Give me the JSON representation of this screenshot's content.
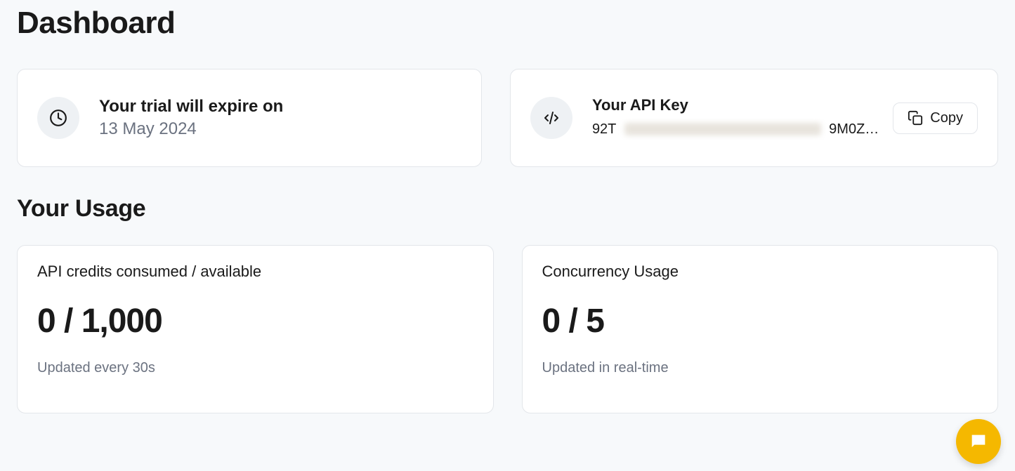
{
  "title": "Dashboard",
  "trial": {
    "label": "Your trial will expire on",
    "date": "13 May 2024"
  },
  "apikey": {
    "label": "Your API Key",
    "prefix": "92T",
    "suffix": "9M0Z…",
    "copy_label": "Copy"
  },
  "usage": {
    "heading": "Your Usage",
    "credits": {
      "title": "API credits consumed / available",
      "value": "0 / 1,000",
      "note": "Updated every 30s"
    },
    "concurrency": {
      "title": "Concurrency Usage",
      "value": "0 / 5",
      "note": "Updated in real-time"
    }
  }
}
